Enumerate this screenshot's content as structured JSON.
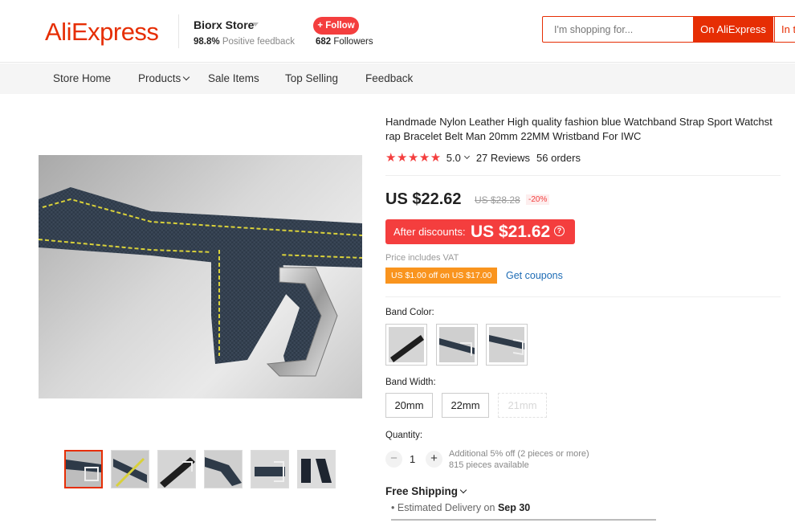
{
  "header": {
    "logo": "AliExpress",
    "store_name": "Biorx Store",
    "feedback_percent": "98.8%",
    "feedback_label": "Positive feedback",
    "follow_label": "+ Follow",
    "followers_count": "682",
    "followers_label": "Followers",
    "search_placeholder": "I'm shopping for...",
    "search_on_aliexpress": "On AliExpress",
    "search_in_store": "In t"
  },
  "nav": {
    "items": [
      "Store Home",
      "Products",
      "Sale Items",
      "Top Selling",
      "Feedback"
    ]
  },
  "product": {
    "title": "Handmade Nylon Leather High quality fashion blue Watchband Strap Sport Watchst rap Bracelet Belt Man 20mm 22MM Wristband For IWC",
    "stars": "★★★★★",
    "rating": "5.0",
    "reviews": "27 Reviews",
    "orders": "56 orders",
    "price": "US $22.62",
    "original_price": "US $28.28",
    "discount": "-20%",
    "after_discount_label": "After discounts:",
    "after_discount_price": "US $21.62",
    "vat_note": "Price includes VAT",
    "coupon_badge": "US $1.00 off on US $17.00",
    "get_coupons": "Get coupons",
    "band_color_label": "Band Color:",
    "band_width_label": "Band Width:",
    "widths": [
      "20mm",
      "22mm",
      "21mm"
    ],
    "quantity_label": "Quantity:",
    "quantity": "1",
    "qty_minus": "−",
    "qty_plus": "+",
    "qty_note_1": "Additional 5% off (2 pieces or more)",
    "qty_note_2": "815 pieces available",
    "free_shipping": "Free Shipping",
    "delivery_label": "Estimated Delivery on",
    "delivery_date": "Sep 30"
  },
  "colors": {
    "accent": "#e62e04",
    "sale_red": "#f43e3e",
    "coupon_orange": "#f9941e",
    "link_blue": "#1e6cb5"
  }
}
